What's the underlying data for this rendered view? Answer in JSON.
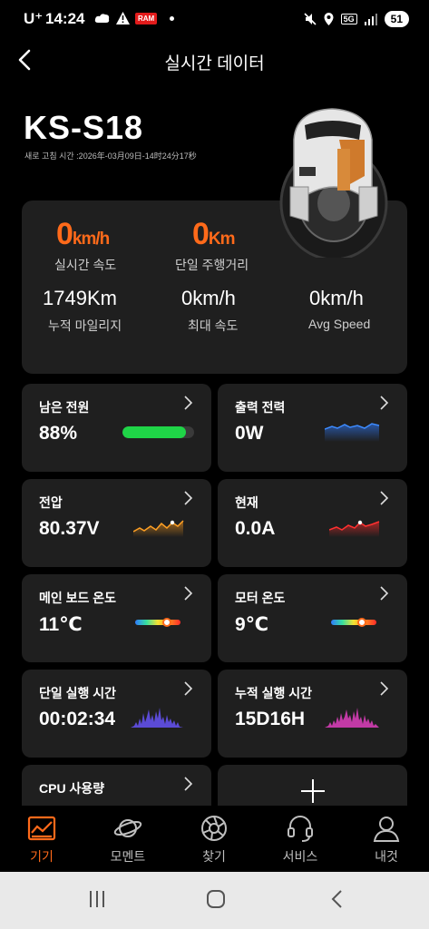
{
  "status_bar": {
    "carrier": "U⁺",
    "time": "14:24",
    "badge": "RAM",
    "network": "5G",
    "battery": "51"
  },
  "header": {
    "title": "실시간 데이터"
  },
  "device": {
    "name": "KS-S18",
    "refresh_time": "새로 고침 시간 :2026年-03月09日-14时24分17秒"
  },
  "summary": {
    "speed": {
      "value": "0",
      "unit": "km/h",
      "label": "실시간 속도"
    },
    "trip_distance": {
      "value": "0",
      "unit": "Km",
      "label": "단일 주행거리"
    },
    "total_mileage": {
      "value": "1749Km",
      "label": "누적 마일리지"
    },
    "max_speed": {
      "value": "0km/h",
      "label": "최대 속도"
    },
    "avg_speed": {
      "value": "0km/h",
      "label": "Avg Speed"
    }
  },
  "tiles": {
    "remaining_power": {
      "label": "남은 전원",
      "value": "88%",
      "level": 0.88
    },
    "output_power": {
      "label": "출력 전력",
      "value": "0W"
    },
    "voltage": {
      "label": "전압",
      "value": "80.37V"
    },
    "current": {
      "label": "현재",
      "value": "0.0A"
    },
    "board_temp": {
      "label": "메인 보드 온도",
      "value": "11℃"
    },
    "motor_temp": {
      "label": "모터 온도",
      "value": "9℃"
    },
    "trip_time": {
      "label": "단일 실행 시간",
      "value": "00:02:34"
    },
    "total_time": {
      "label": "누적 실행 시간",
      "value": "15D16H"
    },
    "cpu": {
      "label": "CPU 사용량"
    }
  },
  "bottom_nav": {
    "items": [
      {
        "label": "기기",
        "icon": "device-icon"
      },
      {
        "label": "모멘트",
        "icon": "planet-icon"
      },
      {
        "label": "찾기",
        "icon": "aperture-icon"
      },
      {
        "label": "서비스",
        "icon": "headset-icon"
      },
      {
        "label": "내것",
        "icon": "user-icon"
      }
    ]
  },
  "colors": {
    "accent": "#ff6a1a",
    "card": "#1f1f1f",
    "battery": "#1fd447"
  }
}
